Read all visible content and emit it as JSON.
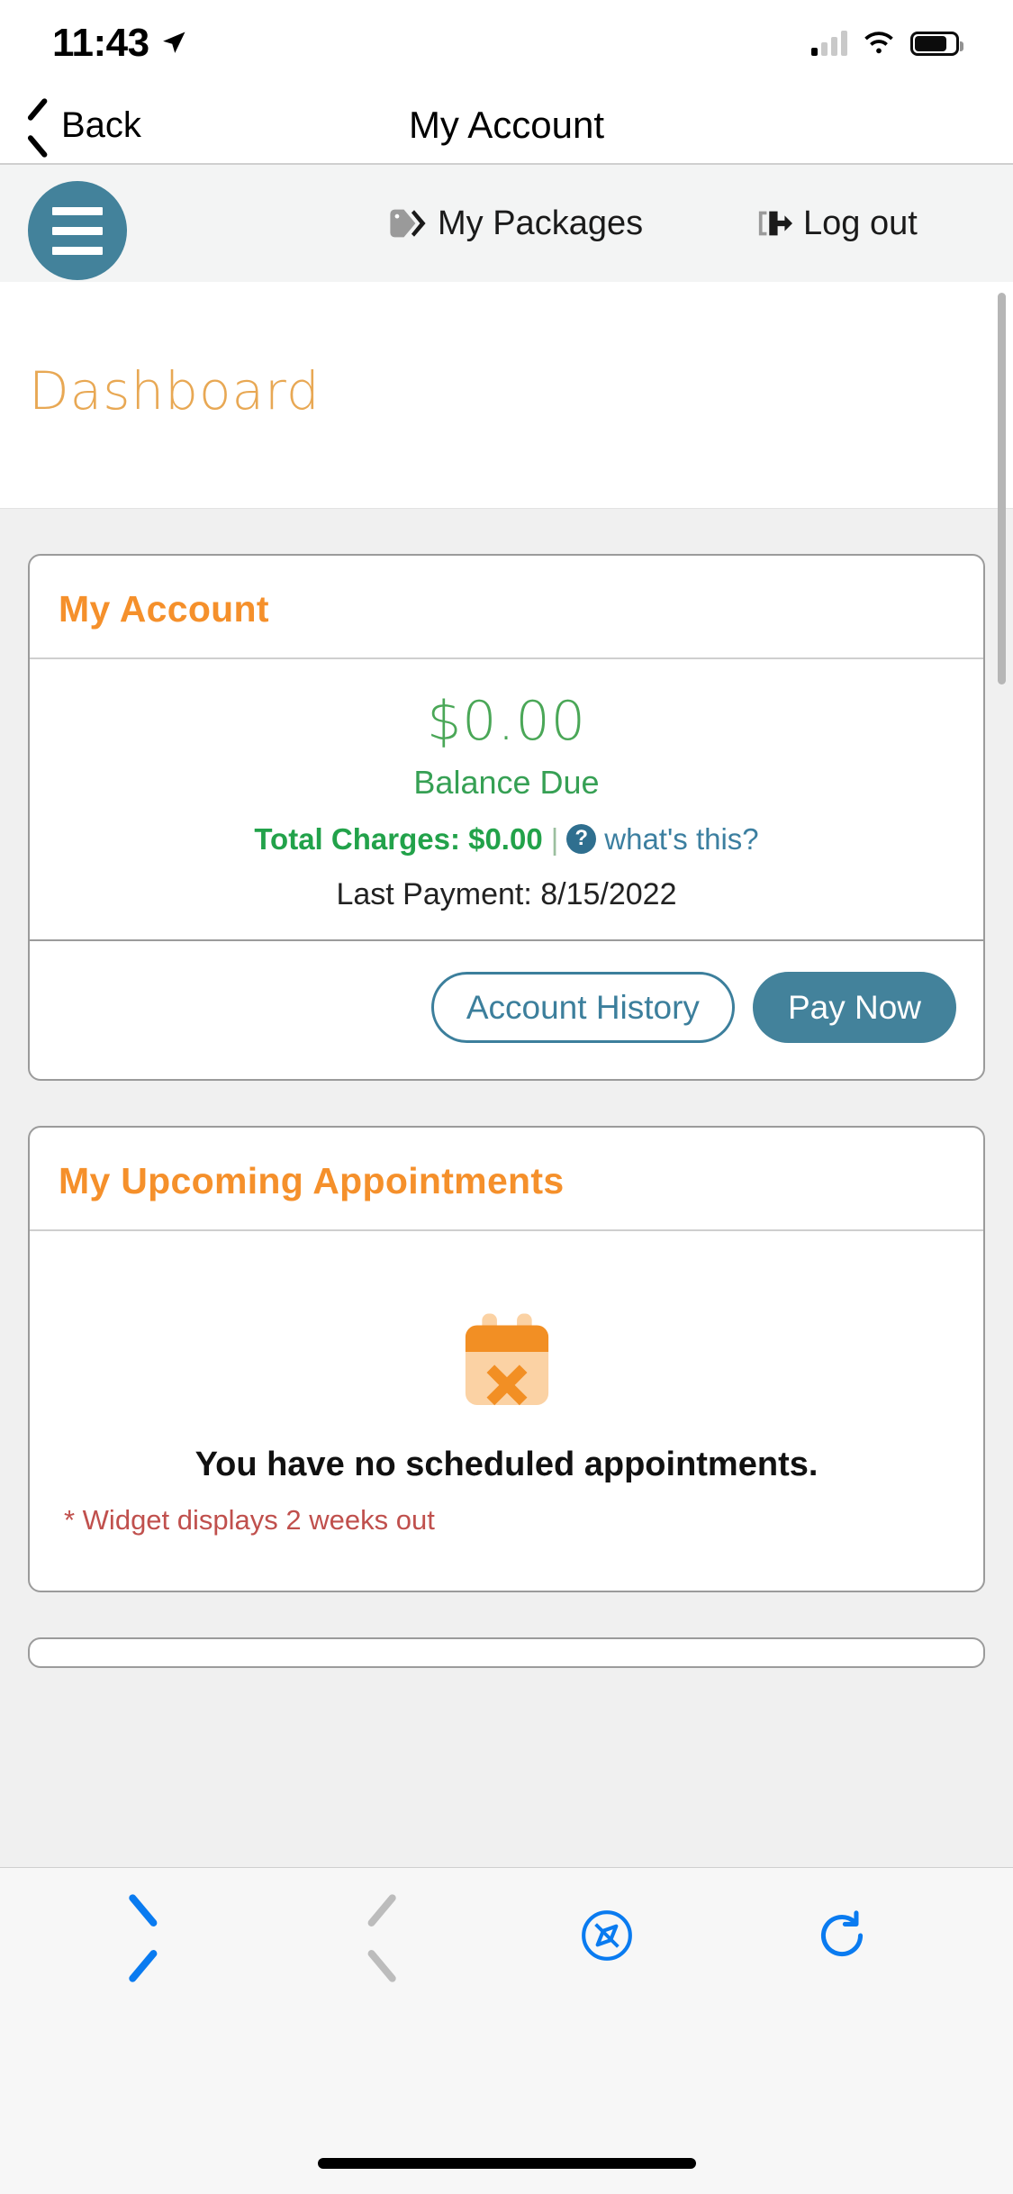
{
  "status_bar": {
    "time": "11:43",
    "location_icon": "location-arrow-icon",
    "signal_icon": "cellular-signal-icon",
    "wifi_icon": "wifi-icon",
    "battery_icon": "battery-icon"
  },
  "nav": {
    "back_label": "Back",
    "back_icon": "chevron-left-icon",
    "title": "My Account"
  },
  "site_toolbar": {
    "menu_icon": "hamburger-menu-icon",
    "packages_label": "My Packages",
    "packages_icon": "tag-icon",
    "logout_label": "Log out",
    "logout_icon": "sign-out-icon"
  },
  "page": {
    "dashboard_title": "Dashboard"
  },
  "account_card": {
    "title": "My Account",
    "balance_amount": "$0.00",
    "balance_label": "Balance Due",
    "total_charges_label": "Total Charges: $0.00",
    "separator": "|",
    "help_icon": "question-circle-icon",
    "whats_this_label": "what's this?",
    "last_payment": "Last Payment: 8/15/2022",
    "history_button": "Account History",
    "pay_button": "Pay Now"
  },
  "appointments_card": {
    "title": "My Upcoming Appointments",
    "empty_icon": "calendar-times-icon",
    "empty_message": "You have no scheduled appointments.",
    "footnote": "* Widget displays 2 weeks out"
  },
  "browser_bar": {
    "back_icon": "chevron-left-icon",
    "forward_icon": "chevron-right-icon",
    "share_icon": "compass-icon",
    "reload_icon": "reload-icon"
  },
  "colors": {
    "teal": "#43829b",
    "orange": "#f5902b",
    "green": "#36a054",
    "link": "#3c7fa0",
    "note_red": "#c0504d"
  }
}
